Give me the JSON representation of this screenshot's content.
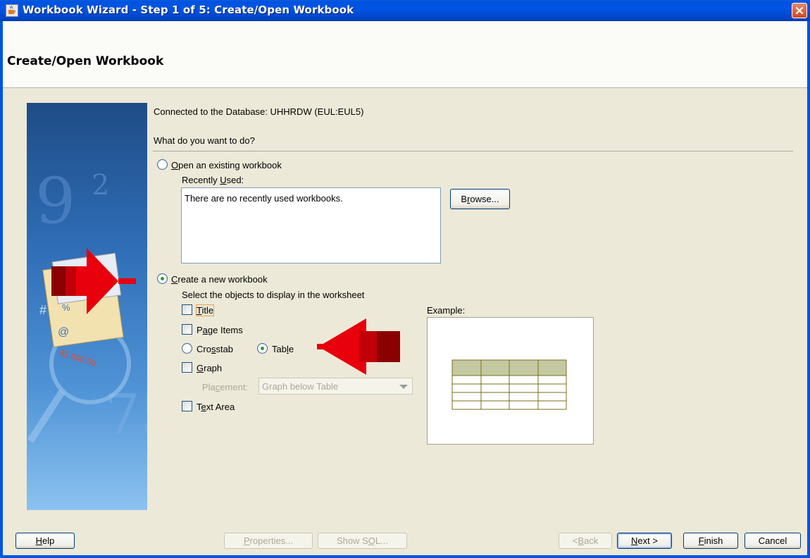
{
  "window": {
    "title": "Workbook Wizard - Step 1 of 5: Create/Open Workbook",
    "icon": "java-cup-icon",
    "close_icon": "close-icon"
  },
  "header": {
    "title": "Create/Open Workbook"
  },
  "content": {
    "connection": "Connected to the Database: UHHRDW (EUL:EUL5)",
    "question": "What do you want to do?",
    "open_existing": {
      "label_mn": "O",
      "label_rest": "pen an existing workbook",
      "selected": false
    },
    "recently_used": {
      "label_pre": "Recently ",
      "label_mn": "U",
      "label_post": "sed:",
      "items": [
        "There are no recently used workbooks."
      ]
    },
    "browse": {
      "label_pre": "B",
      "label_mn": "r",
      "label_post": "owse..."
    },
    "create_new": {
      "label_mn": "C",
      "label_rest": "reate a new workbook",
      "selected": true
    },
    "objects_prompt": "Select the objects to display in the worksheet",
    "objects": {
      "title": {
        "label_mn": "T",
        "label_rest": "itle",
        "checked": false
      },
      "page_items": {
        "label_pre": "P",
        "label_mn": "a",
        "label_post": "ge Items",
        "checked": false
      },
      "crosstab": {
        "label_pre": "Cro",
        "label_mn": "s",
        "label_post": "stab",
        "selected": false
      },
      "table": {
        "label_pre": "Tab",
        "label_mn": "l",
        "label_post": "e",
        "selected": true
      },
      "graph": {
        "label_mn": "G",
        "label_rest": "raph",
        "checked": false
      },
      "placement": {
        "label_pre": "Pla",
        "label_mn": "c",
        "label_post": "ement:",
        "value": "Graph below Table",
        "enabled": false
      },
      "text_area": {
        "label_pre": "T",
        "label_mn": "e",
        "label_post": "xt Area",
        "checked": false
      }
    },
    "example_label": "Example:"
  },
  "footer": {
    "help": {
      "label_mn": "H",
      "label_rest": "elp"
    },
    "properties": {
      "label_mn": "P",
      "label_rest": "roperties...",
      "enabled": false
    },
    "show_sql": {
      "label_pre": "Show S",
      "label_mn": "Q",
      "label_post": "L...",
      "enabled": false
    },
    "back": {
      "label_pre": "< ",
      "label_mn": "B",
      "label_post": "ack",
      "enabled": false
    },
    "next": {
      "label_mn": "N",
      "label_rest": "ext >"
    },
    "finish": {
      "label_mn": "F",
      "label_rest": "inish"
    },
    "cancel": {
      "label": "Cancel"
    }
  },
  "colors": {
    "title_bar": "#0054e3",
    "dialog_bg": "#ece9d8",
    "annotation_arrow": "#e8000c",
    "table_preview_header": "#c5c9a2",
    "table_preview_border": "#7a6e1a"
  }
}
